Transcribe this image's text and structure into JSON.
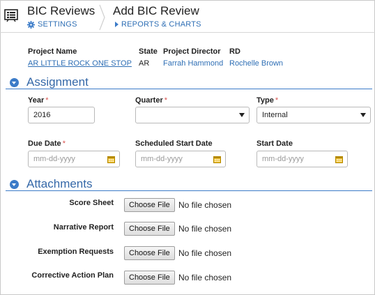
{
  "header": {
    "app_title": "BIC Reviews",
    "settings_label": "SETTINGS",
    "page_title": "Add BIC Review",
    "reports_label": "REPORTS & CHARTS"
  },
  "project": {
    "labels": {
      "name": "Project Name",
      "state": "State",
      "director": "Project Director",
      "rd": "RD"
    },
    "values": {
      "name": "AR LITTLE ROCK ONE STOP",
      "state": "AR",
      "director": "Farrah Hammond",
      "rd": "Rochelle Brown"
    }
  },
  "assignment": {
    "title": "Assignment",
    "year_label": "Year",
    "year_value": "2016",
    "quarter_label": "Quarter",
    "quarter_value": "",
    "type_label": "Type",
    "type_value": "Internal",
    "due_label": "Due Date",
    "sched_label": "Scheduled Start Date",
    "start_label": "Start Date",
    "required_mark": "*",
    "date_placeholder": "mm-dd-yyyy"
  },
  "attachments": {
    "title": "Attachments",
    "choose_label": "Choose File",
    "no_file": "No file chosen",
    "items": [
      {
        "label": "Score Sheet"
      },
      {
        "label": "Narrative Report"
      },
      {
        "label": "Exemption Requests"
      },
      {
        "label": "Corrective Action Plan"
      }
    ]
  },
  "colors": {
    "link": "#2f6fb5",
    "section": "#3568a8",
    "accent": "#3b7bc8",
    "required": "#d9534f"
  }
}
